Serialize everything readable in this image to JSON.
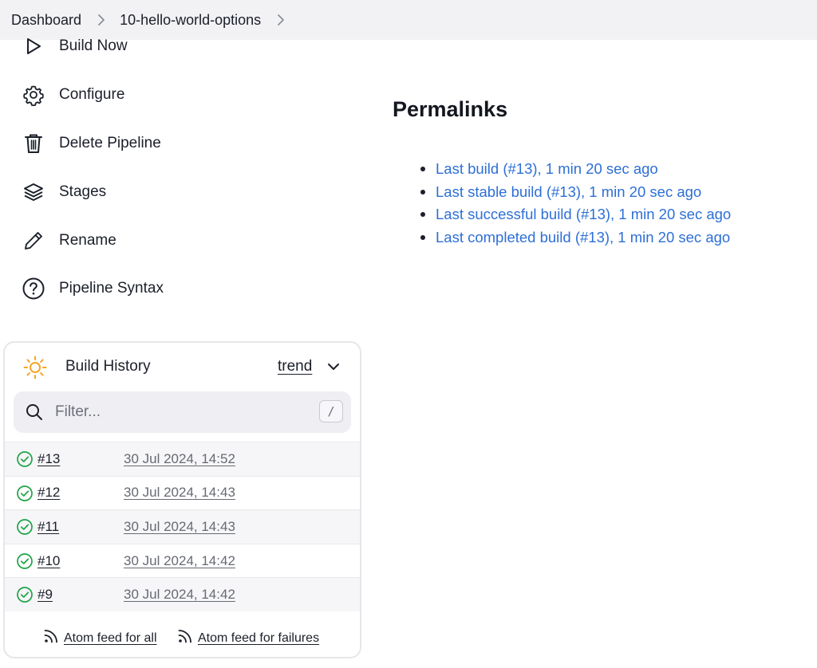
{
  "breadcrumb": {
    "items": [
      "Dashboard",
      "10-hello-world-options"
    ]
  },
  "sidebar": {
    "items": [
      {
        "label": "Build Now",
        "icon": "play-icon"
      },
      {
        "label": "Configure",
        "icon": "gear-icon"
      },
      {
        "label": "Delete Pipeline",
        "icon": "trash-icon"
      },
      {
        "label": "Stages",
        "icon": "layers-icon"
      },
      {
        "label": "Rename",
        "icon": "pencil-icon"
      },
      {
        "label": "Pipeline Syntax",
        "icon": "help-circle-icon"
      }
    ]
  },
  "permalinks": {
    "title": "Permalinks",
    "links": [
      "Last build (#13), 1 min 20 sec ago",
      "Last stable build (#13), 1 min 20 sec ago",
      "Last successful build (#13), 1 min 20 sec ago",
      "Last completed build (#13), 1 min 20 sec ago"
    ]
  },
  "build_history": {
    "title": "Build History",
    "trend_label": "trend",
    "filter": {
      "placeholder": "Filter...",
      "shortcut": "/"
    },
    "builds": [
      {
        "number": "#13",
        "date": "30 Jul 2024, 14:52",
        "status": "success"
      },
      {
        "number": "#12",
        "date": "30 Jul 2024, 14:43",
        "status": "success"
      },
      {
        "number": "#11",
        "date": "30 Jul 2024, 14:43",
        "status": "success"
      },
      {
        "number": "#10",
        "date": "30 Jul 2024, 14:42",
        "status": "success"
      },
      {
        "number": "#9",
        "date": "30 Jul 2024, 14:42",
        "status": "success"
      }
    ],
    "feeds": {
      "all": "Atom feed for all",
      "failures": "Atom feed for failures"
    }
  },
  "colors": {
    "link": "#2d6fd6",
    "success": "#1ea446",
    "sun": "#f5a623"
  }
}
